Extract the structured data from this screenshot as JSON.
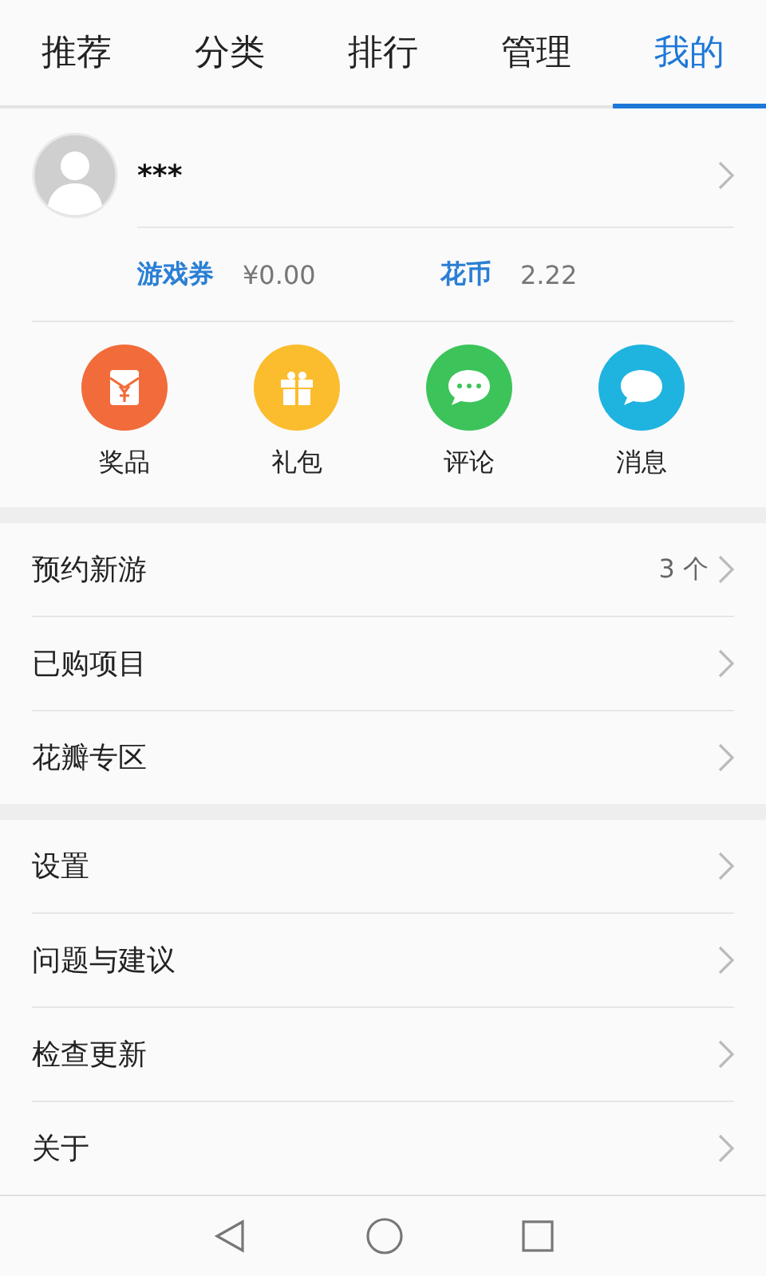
{
  "tabs": [
    {
      "label": "推荐",
      "selected": false
    },
    {
      "label": "分类",
      "selected": false
    },
    {
      "label": "排行",
      "selected": false
    },
    {
      "label": "管理",
      "selected": false
    },
    {
      "label": "我的",
      "selected": true
    }
  ],
  "profile": {
    "name": "***"
  },
  "balances": [
    {
      "label": "游戏券",
      "value": "¥0.00"
    },
    {
      "label": "花币",
      "value": "2.22"
    }
  ],
  "shortcuts": [
    {
      "label": "奖品",
      "kind": "prize",
      "color": "#f26b3a"
    },
    {
      "label": "礼包",
      "kind": "gift",
      "color": "#fbbd2e"
    },
    {
      "label": "评论",
      "kind": "comment",
      "color": "#3cc45a"
    },
    {
      "label": "消息",
      "kind": "message",
      "color": "#1fb3e0"
    }
  ],
  "menu_groups": [
    {
      "items": [
        {
          "label": "预约新游",
          "count": "3 个"
        },
        {
          "label": "已购项目"
        },
        {
          "label": "花瓣专区"
        }
      ]
    },
    {
      "items": [
        {
          "label": "设置"
        },
        {
          "label": "问题与建议"
        },
        {
          "label": "检查更新"
        },
        {
          "label": "关于"
        }
      ]
    }
  ]
}
